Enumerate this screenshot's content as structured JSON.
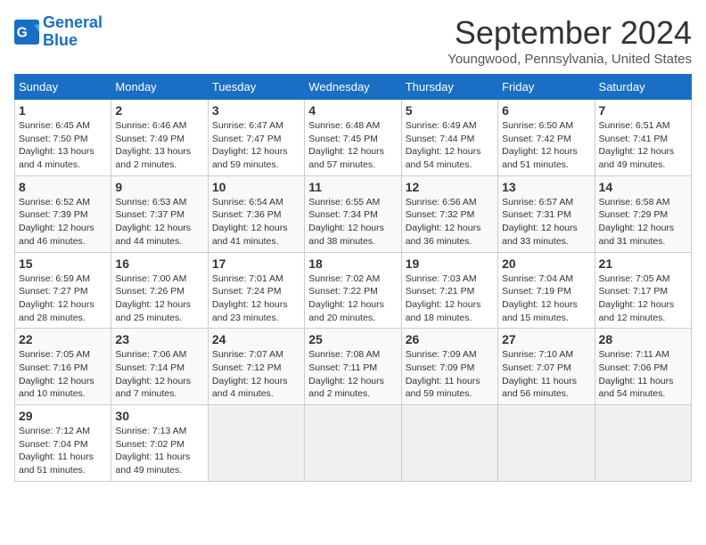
{
  "logo": {
    "line1": "General",
    "line2": "Blue"
  },
  "title": "September 2024",
  "location": "Youngwood, Pennsylvania, United States",
  "days_of_week": [
    "Sunday",
    "Monday",
    "Tuesday",
    "Wednesday",
    "Thursday",
    "Friday",
    "Saturday"
  ],
  "weeks": [
    [
      {
        "day": "1",
        "sunrise": "Sunrise: 6:45 AM",
        "sunset": "Sunset: 7:50 PM",
        "daylight": "Daylight: 13 hours and 4 minutes."
      },
      {
        "day": "2",
        "sunrise": "Sunrise: 6:46 AM",
        "sunset": "Sunset: 7:49 PM",
        "daylight": "Daylight: 13 hours and 2 minutes."
      },
      {
        "day": "3",
        "sunrise": "Sunrise: 6:47 AM",
        "sunset": "Sunset: 7:47 PM",
        "daylight": "Daylight: 12 hours and 59 minutes."
      },
      {
        "day": "4",
        "sunrise": "Sunrise: 6:48 AM",
        "sunset": "Sunset: 7:45 PM",
        "daylight": "Daylight: 12 hours and 57 minutes."
      },
      {
        "day": "5",
        "sunrise": "Sunrise: 6:49 AM",
        "sunset": "Sunset: 7:44 PM",
        "daylight": "Daylight: 12 hours and 54 minutes."
      },
      {
        "day": "6",
        "sunrise": "Sunrise: 6:50 AM",
        "sunset": "Sunset: 7:42 PM",
        "daylight": "Daylight: 12 hours and 51 minutes."
      },
      {
        "day": "7",
        "sunrise": "Sunrise: 6:51 AM",
        "sunset": "Sunset: 7:41 PM",
        "daylight": "Daylight: 12 hours and 49 minutes."
      }
    ],
    [
      {
        "day": "8",
        "sunrise": "Sunrise: 6:52 AM",
        "sunset": "Sunset: 7:39 PM",
        "daylight": "Daylight: 12 hours and 46 minutes."
      },
      {
        "day": "9",
        "sunrise": "Sunrise: 6:53 AM",
        "sunset": "Sunset: 7:37 PM",
        "daylight": "Daylight: 12 hours and 44 minutes."
      },
      {
        "day": "10",
        "sunrise": "Sunrise: 6:54 AM",
        "sunset": "Sunset: 7:36 PM",
        "daylight": "Daylight: 12 hours and 41 minutes."
      },
      {
        "day": "11",
        "sunrise": "Sunrise: 6:55 AM",
        "sunset": "Sunset: 7:34 PM",
        "daylight": "Daylight: 12 hours and 38 minutes."
      },
      {
        "day": "12",
        "sunrise": "Sunrise: 6:56 AM",
        "sunset": "Sunset: 7:32 PM",
        "daylight": "Daylight: 12 hours and 36 minutes."
      },
      {
        "day": "13",
        "sunrise": "Sunrise: 6:57 AM",
        "sunset": "Sunset: 7:31 PM",
        "daylight": "Daylight: 12 hours and 33 minutes."
      },
      {
        "day": "14",
        "sunrise": "Sunrise: 6:58 AM",
        "sunset": "Sunset: 7:29 PM",
        "daylight": "Daylight: 12 hours and 31 minutes."
      }
    ],
    [
      {
        "day": "15",
        "sunrise": "Sunrise: 6:59 AM",
        "sunset": "Sunset: 7:27 PM",
        "daylight": "Daylight: 12 hours and 28 minutes."
      },
      {
        "day": "16",
        "sunrise": "Sunrise: 7:00 AM",
        "sunset": "Sunset: 7:26 PM",
        "daylight": "Daylight: 12 hours and 25 minutes."
      },
      {
        "day": "17",
        "sunrise": "Sunrise: 7:01 AM",
        "sunset": "Sunset: 7:24 PM",
        "daylight": "Daylight: 12 hours and 23 minutes."
      },
      {
        "day": "18",
        "sunrise": "Sunrise: 7:02 AM",
        "sunset": "Sunset: 7:22 PM",
        "daylight": "Daylight: 12 hours and 20 minutes."
      },
      {
        "day": "19",
        "sunrise": "Sunrise: 7:03 AM",
        "sunset": "Sunset: 7:21 PM",
        "daylight": "Daylight: 12 hours and 18 minutes."
      },
      {
        "day": "20",
        "sunrise": "Sunrise: 7:04 AM",
        "sunset": "Sunset: 7:19 PM",
        "daylight": "Daylight: 12 hours and 15 minutes."
      },
      {
        "day": "21",
        "sunrise": "Sunrise: 7:05 AM",
        "sunset": "Sunset: 7:17 PM",
        "daylight": "Daylight: 12 hours and 12 minutes."
      }
    ],
    [
      {
        "day": "22",
        "sunrise": "Sunrise: 7:05 AM",
        "sunset": "Sunset: 7:16 PM",
        "daylight": "Daylight: 12 hours and 10 minutes."
      },
      {
        "day": "23",
        "sunrise": "Sunrise: 7:06 AM",
        "sunset": "Sunset: 7:14 PM",
        "daylight": "Daylight: 12 hours and 7 minutes."
      },
      {
        "day": "24",
        "sunrise": "Sunrise: 7:07 AM",
        "sunset": "Sunset: 7:12 PM",
        "daylight": "Daylight: 12 hours and 4 minutes."
      },
      {
        "day": "25",
        "sunrise": "Sunrise: 7:08 AM",
        "sunset": "Sunset: 7:11 PM",
        "daylight": "Daylight: 12 hours and 2 minutes."
      },
      {
        "day": "26",
        "sunrise": "Sunrise: 7:09 AM",
        "sunset": "Sunset: 7:09 PM",
        "daylight": "Daylight: 11 hours and 59 minutes."
      },
      {
        "day": "27",
        "sunrise": "Sunrise: 7:10 AM",
        "sunset": "Sunset: 7:07 PM",
        "daylight": "Daylight: 11 hours and 56 minutes."
      },
      {
        "day": "28",
        "sunrise": "Sunrise: 7:11 AM",
        "sunset": "Sunset: 7:06 PM",
        "daylight": "Daylight: 11 hours and 54 minutes."
      }
    ],
    [
      {
        "day": "29",
        "sunrise": "Sunrise: 7:12 AM",
        "sunset": "Sunset: 7:04 PM",
        "daylight": "Daylight: 11 hours and 51 minutes."
      },
      {
        "day": "30",
        "sunrise": "Sunrise: 7:13 AM",
        "sunset": "Sunset: 7:02 PM",
        "daylight": "Daylight: 11 hours and 49 minutes."
      },
      null,
      null,
      null,
      null,
      null
    ]
  ]
}
